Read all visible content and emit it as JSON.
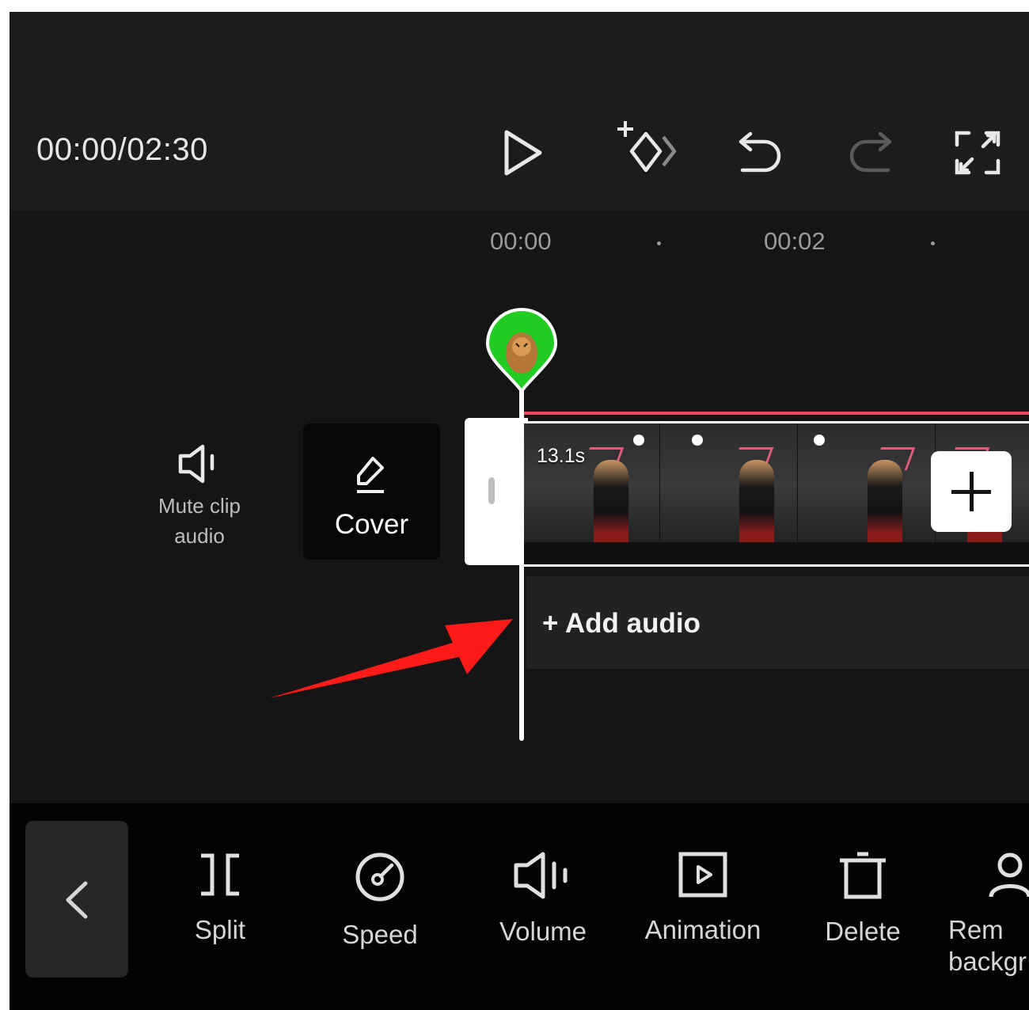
{
  "header": {
    "timecode": "00:00/02:30",
    "buttons": {
      "play": "play-icon",
      "keyframe": "keyframe-add-icon",
      "undo": "undo-icon",
      "redo": "redo-icon",
      "fullscreen": "fullscreen-icon"
    }
  },
  "timeline": {
    "ruler": [
      "00:00",
      "00:02"
    ],
    "mute": {
      "label": "Mute clip\naudio",
      "icon": "speaker-icon"
    },
    "cover": {
      "label": "Cover",
      "icon": "pencil-icon"
    },
    "clip": {
      "duration": "13.1s"
    },
    "add_audio": {
      "label": "Add audio"
    }
  },
  "toolbar": {
    "back_icon": "chevron-left-icon",
    "tools": [
      {
        "label": "Split",
        "icon": "split-icon"
      },
      {
        "label": "Speed",
        "icon": "speed-icon"
      },
      {
        "label": "Volume",
        "icon": "volume-icon"
      },
      {
        "label": "Animation",
        "icon": "animation-icon"
      },
      {
        "label": "Delete",
        "icon": "delete-icon"
      },
      {
        "label": "Rem\nbackgr",
        "icon": "person-icon"
      }
    ]
  },
  "colors": {
    "accent_red": "#e64a60",
    "annotation_arrow": "#ff1a1a",
    "marker_green": "#22cc22"
  }
}
